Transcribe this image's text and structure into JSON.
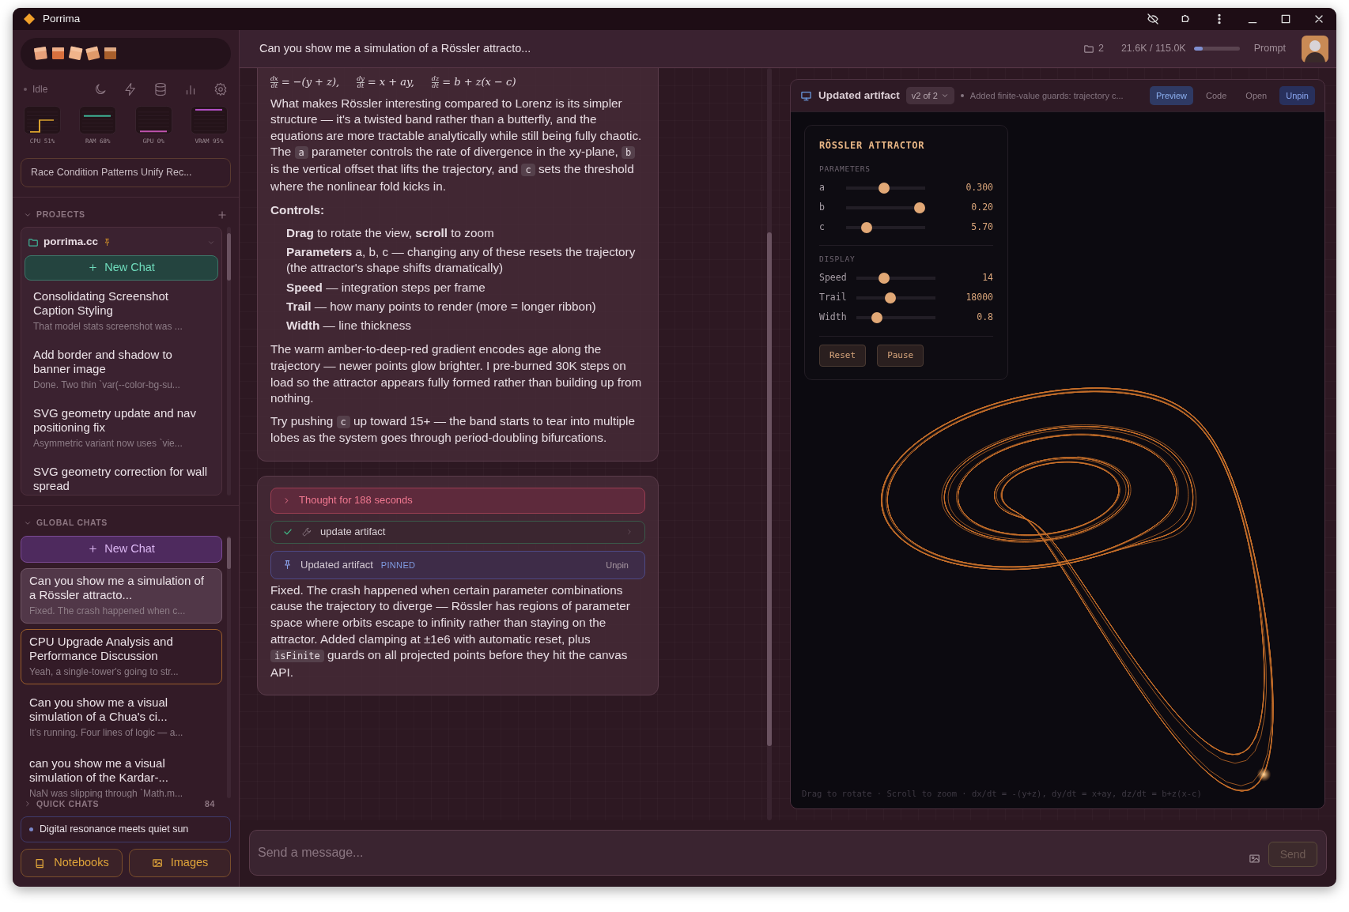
{
  "window": {
    "title": "Porrima"
  },
  "sidebar": {
    "status": "Idle",
    "monitors": [
      {
        "label": "CPU 51%",
        "color": "#d9a22e",
        "kind": "step"
      },
      {
        "label": "RAM 68%",
        "color": "#3fb89a",
        "kind": "upper"
      },
      {
        "label": "GPU 0%",
        "color": "#c254b0",
        "kind": "bottom"
      },
      {
        "label": "VRAM 95%",
        "color": "#b552c8",
        "kind": "top"
      }
    ],
    "search": {
      "value": "Race Condition Patterns Unify Rec..."
    },
    "projects": {
      "title": "PROJECTS",
      "expanded": true,
      "project": {
        "name": "porrima.cc",
        "pinned": true,
        "expanded": true,
        "new_chat": "New Chat",
        "chats": [
          {
            "title": "Consolidating Screenshot Caption Styling",
            "preview": "That model stats screenshot was ..."
          },
          {
            "title": "Add border and shadow to banner image",
            "preview": "Done. Two thin `var(--color-bg-su..."
          },
          {
            "title": "SVG geometry update and nav positioning fix",
            "preview": "Asymmetric variant now uses `vie..."
          },
          {
            "title": "SVG geometry correction for wall spread"
          }
        ]
      }
    },
    "global_chats": {
      "title": "GLOBAL CHATS",
      "expanded": true,
      "new_chat": "New Chat",
      "chats": [
        {
          "title": "Can you show me a simulation of a Rössler attracto...",
          "preview": "Fixed. The crash happened when c...",
          "selected": true,
          "outlined": false
        },
        {
          "title": "CPU Upgrade Analysis and Performance Discussion",
          "preview": "Yeah, a single-tower's going to str...",
          "selected": false,
          "outlined": true
        },
        {
          "title": "Can you show me a visual simulation of a Chua's ci...",
          "preview": "It's running. Four lines of logic — a...",
          "selected": false,
          "outlined": false
        },
        {
          "title": "can you show me a visual simulation of the Kardar-...",
          "preview": "NaN was slipping through `Math.m...",
          "selected": false,
          "outlined": false
        }
      ]
    },
    "quick_chats": {
      "title": "QUICK CHATS",
      "expanded": false,
      "count": "84",
      "items": [
        {
          "title": "Digital resonance meets quiet sun"
        }
      ]
    },
    "buttons": [
      {
        "label": "Notebooks",
        "kind": "notebook"
      },
      {
        "label": "Images",
        "kind": "image"
      }
    ]
  },
  "header": {
    "title": "Can you show me a simulation of a Rössler attracto...",
    "folder_count": "2",
    "token_meter": {
      "reading": "21.6K / 115.0K",
      "level": 0.19
    },
    "prompt": "Prompt"
  },
  "chat": {
    "messages": [
      {
        "blocks": [
          {
            "kind": "equations",
            "items": [
              {
                "num": "dx",
                "den": "dt",
                "rhs": "= −(y + z),"
              },
              {
                "num": "dy",
                "den": "dt",
                "rhs": "= x + ay,"
              },
              {
                "num": "dz",
                "den": "dt",
                "rhs": "= b + z(x − c)"
              }
            ]
          },
          {
            "kind": "paragraph",
            "segments": [
              {
                "text": "What makes Rössler interesting compared to Lorenz is its simpler structure — it's a twisted band rather than a butterfly, and the equations are more tractable analytically while still being fully chaotic. The "
              },
              {
                "code": "a"
              },
              {
                "text": " parameter controls the rate of divergence in the xy-plane, "
              },
              {
                "code": "b"
              },
              {
                "text": " is the vertical offset that lifts the trajectory, and "
              },
              {
                "code": "c"
              },
              {
                "text": " sets the threshold where the nonlinear fold kicks in."
              }
            ]
          },
          {
            "kind": "heading",
            "text": "Controls:"
          },
          {
            "kind": "list",
            "items": [
              "**Drag** to rotate the view, **scroll** to zoom",
              "**Parameters** a, b, c — changing any of these resets the trajectory (the attractor's shape shifts dramatically)",
              "**Speed** — integration steps per frame",
              "**Trail** — how many points to render (more = longer ribbon)",
              "**Width** — line thickness"
            ]
          },
          {
            "kind": "paragraph",
            "segments": [
              {
                "text": "The warm amber-to-deep-red gradient encodes age along the trajectory — newer points glow brighter. I pre-burned 30K steps on load so the attractor appears fully formed rather than building up from nothing."
              }
            ]
          },
          {
            "kind": "paragraph",
            "segments": [
              {
                "text": "Try pushing "
              },
              {
                "code": "c"
              },
              {
                "text": " up toward 15+ — the band starts to tear into multiple lobes as the system goes through period-doubling bifurcations."
              }
            ]
          }
        ]
      },
      {
        "blocks": [
          {
            "kind": "thought",
            "text": "Thought for 188 seconds",
            "expanded": false
          },
          {
            "kind": "tool",
            "text": "update artifact",
            "done": true,
            "expanded": false
          },
          {
            "kind": "artifact",
            "text": "Updated artifact",
            "badge": "PINNED",
            "action": "Unpin"
          },
          {
            "kind": "paragraph",
            "segments": [
              {
                "text": "Fixed. The crash happened when certain parameter combinations cause the trajectory to diverge — Rössler has regions of parameter space where orbits escape to infinity rather than staying on the attractor. Added clamping at ±1e6 with automatic reset, plus "
              },
              {
                "code": "isFinite"
              },
              {
                "text": " guards on all projected points before they hit the canvas API."
              }
            ]
          }
        ]
      }
    ]
  },
  "artifact": {
    "title": "Updated artifact",
    "version": "v2 of 2",
    "note": "Added finite-value guards: trajectory c...",
    "tabs": [
      {
        "label": "Preview",
        "selected": true
      },
      {
        "label": "Code",
        "selected": false
      },
      {
        "label": "Open",
        "selected": false
      }
    ],
    "unpin": "Unpin",
    "preview": {
      "title": "RÖSSLER ATTRACTOR",
      "groups": [
        {
          "title": "PARAMETERS",
          "sliders": [
            {
              "label": "a",
              "level": 0.48,
              "reading": "0.300"
            },
            {
              "label": "b",
              "level": 0.93,
              "reading": "0.20"
            },
            {
              "label": "c",
              "level": 0.26,
              "reading": "5.70"
            }
          ]
        },
        {
          "title": "DISPLAY",
          "sliders": [
            {
              "label": "Speed",
              "level": 0.35,
              "reading": "14"
            },
            {
              "label": "Trail",
              "level": 0.43,
              "reading": "18000"
            },
            {
              "label": "Width",
              "level": 0.26,
              "reading": "0.8"
            }
          ]
        }
      ],
      "buttons": [
        "Reset",
        "Pause"
      ],
      "footer": "Drag to rotate · Scroll to zoom · dx/dt = -(y+z), dy/dt = x+ay, dz/dt = b+z(x-c)"
    }
  },
  "composer": {
    "placeholder": "Send a message...",
    "send": {
      "label": "Send",
      "disabled": true
    }
  }
}
